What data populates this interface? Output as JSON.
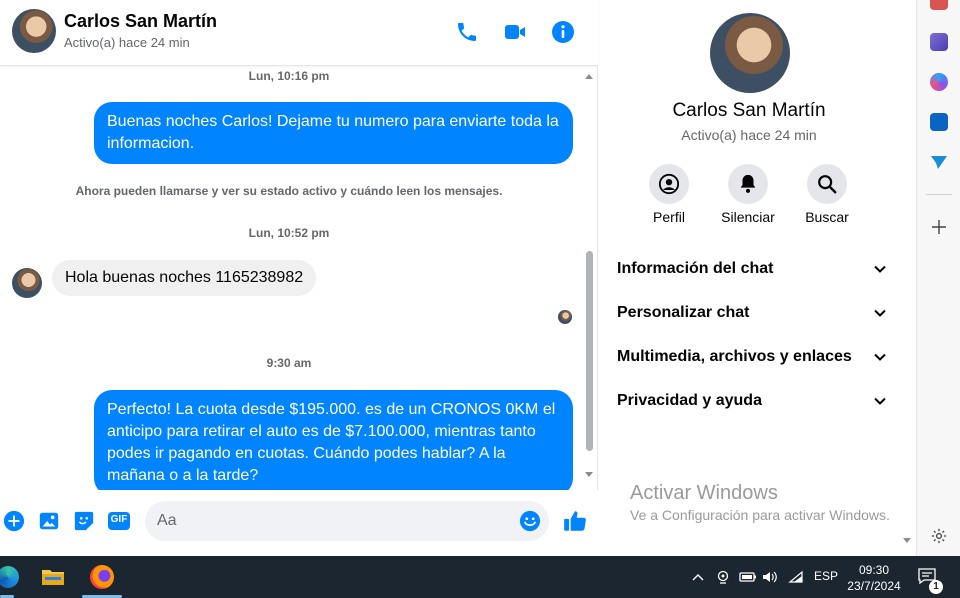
{
  "colors": {
    "accent": "#0084ff",
    "incoming_bubble": "#f0f0f0",
    "muted_text": "#65676b",
    "taskbar": "#1c2630"
  },
  "contact": {
    "name": "Carlos San Martín",
    "status": "Activo(a) hace 24 min"
  },
  "header_icons": [
    "phone-icon",
    "video-camera-icon",
    "info-icon"
  ],
  "messages": {
    "ts1": "Lun, 10:16 pm",
    "m1": "Buenas noches Carlos! Dejame tu numero para enviarte toda la informacion.",
    "notice": "Ahora pueden llamarse y ver su estado activo y cuándo leen los mensajes.",
    "ts2": "Lun, 10:52 pm",
    "m2": "Hola buenas noches 1165238982",
    "ts3": "9:30 am",
    "m3": "Perfecto! La cuota desde $195.000. es de un CRONOS 0KM el anticipo para retirar el auto es de $7.100.000, mientras tanto podes ir pagando en cuotas. Cuándo podes hablar? A la mañana o a la tarde?"
  },
  "composer": {
    "placeholder": "Aa",
    "icons": [
      "plus-icon",
      "image-icon",
      "sticker-icon",
      "gif-icon",
      "emoji-icon",
      "thumbs-up-icon"
    ],
    "gif_label": "GIF"
  },
  "info": {
    "name": "Carlos San Martín",
    "status": "Activo(a) hace 24 min",
    "actions": [
      {
        "label": "Perfil",
        "icon": "profile-icon"
      },
      {
        "label": "Silenciar",
        "icon": "bell-icon"
      },
      {
        "label": "Buscar",
        "icon": "search-icon"
      }
    ],
    "sections": [
      "Información del chat",
      "Personalizar chat",
      "Multimedia, archivos y enlaces",
      "Privacidad y ayuda"
    ]
  },
  "watermark": {
    "title": "Activar Windows",
    "subtitle": "Ve a Configuración para activar Windows."
  },
  "edge_sidebar": {
    "icons": [
      "toolbox-icon",
      "chess-icon",
      "copilot-icon",
      "outlook-icon",
      "send-icon",
      "add-icon",
      "settings-icon"
    ]
  },
  "taskbar": {
    "apps": [
      "edge-icon",
      "file-explorer-icon",
      "firefox-icon"
    ],
    "lang": "ESP",
    "time": "09:30",
    "date": "23/7/2024",
    "notifications": "1"
  }
}
